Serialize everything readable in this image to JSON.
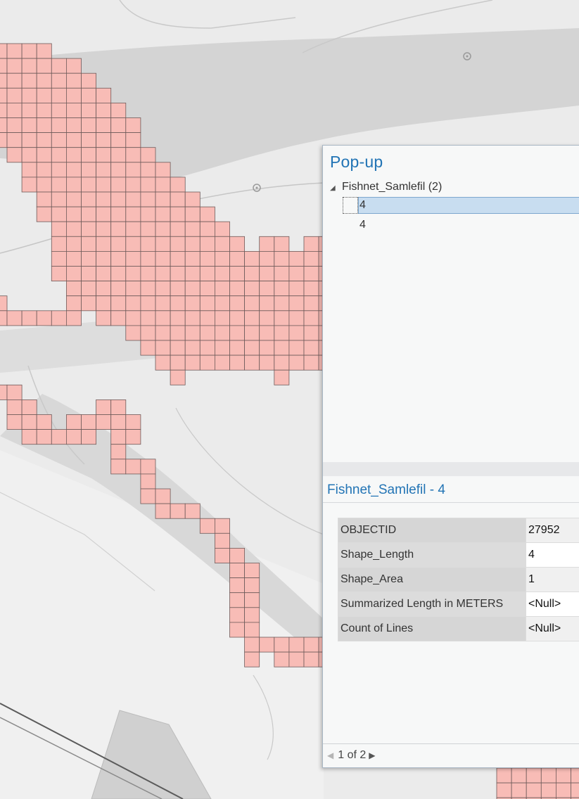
{
  "popup": {
    "title": "Pop-up",
    "layer_name": "Fishnet_Samlefil (2)",
    "features": [
      "4",
      "4"
    ],
    "selected_index": 0,
    "detail_title": "Fishnet_Samlefil - 4",
    "fields": [
      {
        "name": "OBJECTID",
        "value": "27952"
      },
      {
        "name": "Shape_Length",
        "value": "4"
      },
      {
        "name": "Shape_Area",
        "value": "1"
      },
      {
        "name": "Summarized Length in METERS",
        "value": "<Null>"
      },
      {
        "name": "Count of Lines",
        "value": "<Null>"
      }
    ],
    "pager": "1 of 2"
  },
  "icons": {
    "expand": "triangle-down-icon",
    "prev": "triangle-left-icon",
    "next": "triangle-right-icon"
  },
  "colors": {
    "cell_fill": "#f8bcb6",
    "cell_stroke": "#6e5b5a",
    "accent": "#2274b5",
    "selection": "#c8ddf0"
  }
}
